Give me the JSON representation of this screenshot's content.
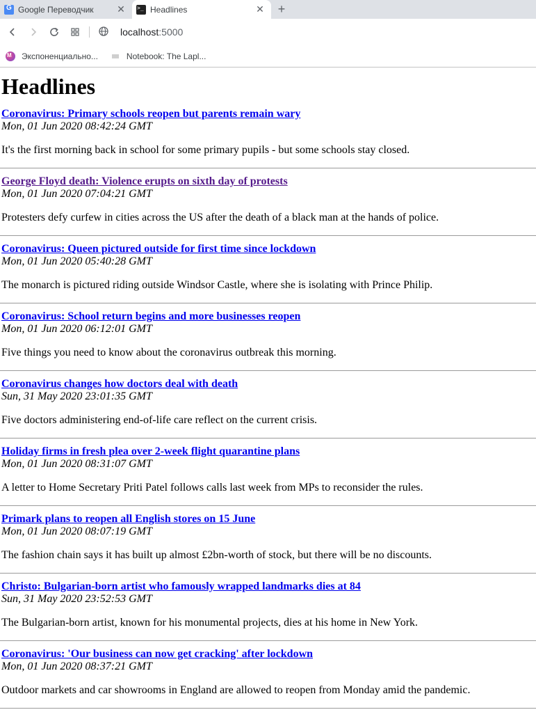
{
  "tabs": [
    {
      "title": "Google Переводчик",
      "icon": "google-translate-icon"
    },
    {
      "title": "Headlines",
      "icon": "terminal-icon"
    }
  ],
  "address_bar": {
    "host": "localhost",
    "port": ":5000"
  },
  "bookmarks": [
    {
      "label": "Экспоненциально..."
    },
    {
      "label": "Notebook: The Lapl..."
    }
  ],
  "page": {
    "heading": "Headlines"
  },
  "articles": [
    {
      "title": "Coronavirus: Primary schools reopen but parents remain wary",
      "date": "Mon, 01 Jun 2020 08:42:24 GMT",
      "summary": "It's the first morning back in school for some primary pupils - but some schools stay closed.",
      "visited": false
    },
    {
      "title": "George Floyd death: Violence erupts on sixth day of protests",
      "date": "Mon, 01 Jun 2020 07:04:21 GMT",
      "summary": "Protesters defy curfew in cities across the US after the death of a black man at the hands of police.",
      "visited": true
    },
    {
      "title": "Coronavirus: Queen pictured outside for first time since lockdown",
      "date": "Mon, 01 Jun 2020 05:40:28 GMT",
      "summary": "The monarch is pictured riding outside Windsor Castle, where she is isolating with Prince Philip.",
      "visited": false
    },
    {
      "title": "Coronavirus: School return begins and more businesses reopen",
      "date": "Mon, 01 Jun 2020 06:12:01 GMT",
      "summary": "Five things you need to know about the coronavirus outbreak this morning.",
      "visited": false
    },
    {
      "title": "Coronavirus changes how doctors deal with death",
      "date": "Sun, 31 May 2020 23:01:35 GMT",
      "summary": "Five doctors administering end-of-life care reflect on the current crisis.",
      "visited": false
    },
    {
      "title": "Holiday firms in fresh plea over 2-week flight quarantine plans",
      "date": "Mon, 01 Jun 2020 08:31:07 GMT",
      "summary": "A letter to Home Secretary Priti Patel follows calls last week from MPs to reconsider the rules.",
      "visited": false
    },
    {
      "title": "Primark plans to reopen all English stores on 15 June",
      "date": "Mon, 01 Jun 2020 08:07:19 GMT",
      "summary": "The fashion chain says it has built up almost £2bn-worth of stock, but there will be no discounts.",
      "visited": false
    },
    {
      "title": "Christo: Bulgarian-born artist who famously wrapped landmarks dies at 84",
      "date": "Sun, 31 May 2020 23:52:53 GMT",
      "summary": "The Bulgarian-born artist, known for his monumental projects, dies at his home in New York.",
      "visited": false
    },
    {
      "title": "Coronavirus: 'Our business can now get cracking' after lockdown",
      "date": "Mon, 01 Jun 2020 08:37:21 GMT",
      "summary": "Outdoor markets and car showrooms in England are allowed to reopen from Monday amid the pandemic.",
      "visited": false
    }
  ],
  "colors": {
    "link": "#0000ee",
    "visited_link": "#551a8b",
    "tabstrip": "#dee1e6"
  }
}
